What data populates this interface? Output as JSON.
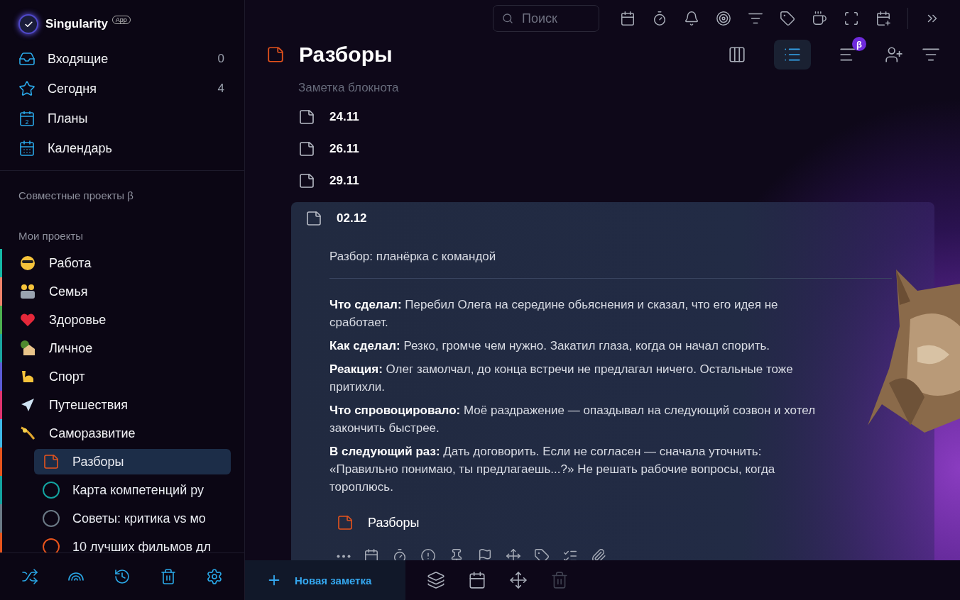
{
  "app": {
    "name": "Singularity",
    "badge": "App"
  },
  "nav": [
    {
      "label": "Входящие",
      "count": "0"
    },
    {
      "label": "Сегодня",
      "count": "4"
    },
    {
      "label": "Планы",
      "icon_text": "2"
    },
    {
      "label": "Календарь"
    }
  ],
  "shared_heading": "Совместные проекты β",
  "projects_heading": "Мои проекты",
  "projects": [
    {
      "label": "Работа",
      "color": "#14b8a6"
    },
    {
      "label": "Семья",
      "color": "#f0826a"
    },
    {
      "label": "Здоровье",
      "color": "#4caf50"
    },
    {
      "label": "Личное",
      "color": "#1aa5a0"
    },
    {
      "label": "Спорт",
      "color": "#5b5bd6"
    },
    {
      "label": "Путешествия",
      "color": "#e0336f"
    },
    {
      "label": "Саморазвитие",
      "color": "#3db8e8",
      "children": [
        {
          "label": "Разборы",
          "kind": "notebook",
          "color": "#e8541c",
          "selected": true
        },
        {
          "label": "Карта компетенций ру",
          "kind": "project",
          "color": "#13a3a0",
          "selected": false
        },
        {
          "label": "Советы: критика vs мо",
          "kind": "project",
          "color": "#6b7a86",
          "selected": false
        },
        {
          "label": "10 лучших фильмов дл",
          "kind": "project",
          "color": "#e8541c",
          "selected": false
        }
      ]
    }
  ],
  "search": {
    "placeholder": "Поиск"
  },
  "views": [
    {
      "selected": false
    },
    {
      "selected": true
    },
    {
      "selected": false,
      "badge": "β"
    }
  ],
  "page": {
    "title": "Разборы",
    "subtitle": "Заметка блокнота"
  },
  "notes": [
    {
      "title": "24.11",
      "expanded": false
    },
    {
      "title": "26.11",
      "expanded": false
    },
    {
      "title": "29.11",
      "expanded": false
    },
    {
      "title": "02.12",
      "expanded": true,
      "heading": "Разбор: планёрка с командой",
      "notebook": "Разборы",
      "paragraphs": [
        "**Что сделал:** Перебил Олега на середине обьяснения и сказал, что его идея не сработает.",
        "**Как сделал:** Резко, громче чем нужно. Закатил глаза, когда он начал спорить.",
        "**Реакция:** Олег замолчал, до конца встречи не предлагал ничего. Остальные тоже притихли.",
        "**Что спровоцировало:** Моё раздражение — опаздывал на следующий созвон и хотел закончить быстрее.",
        "**В следующий раз:** Дать договорить. Если не согласен — сначала уточнить: «Правильно понимаю, ты предлагаешь...?» Не решать рабочие вопросы, когда тороплюсь."
      ]
    }
  ],
  "new_note": {
    "label": "Новая заметка"
  },
  "bottom_actions": [
    {
      "disabled": false
    },
    {
      "disabled": false
    },
    {
      "disabled": false
    },
    {
      "disabled": true
    }
  ]
}
